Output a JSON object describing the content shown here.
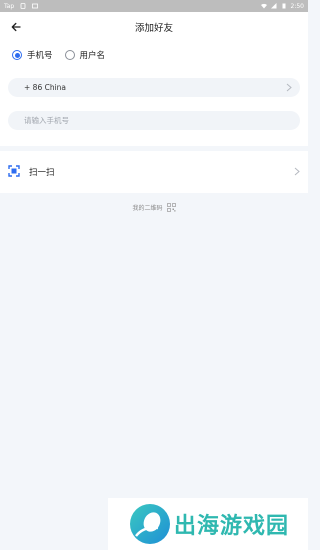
{
  "statusbar": {
    "left_text": "Tap",
    "time": "2:50"
  },
  "header": {
    "title": "添加好友",
    "back_icon": "arrow-left-icon"
  },
  "search_mode": {
    "options": [
      {
        "label": "手机号",
        "checked": true
      },
      {
        "label": "用户名",
        "checked": false
      }
    ],
    "accent": "#2d6cf0"
  },
  "country": {
    "value": "+ 86 China"
  },
  "phone": {
    "placeholder": "请输入手机号"
  },
  "scan": {
    "label": "扫一扫",
    "icon": "scan-icon"
  },
  "my_qr": {
    "label": "我的二维码",
    "icon": "qr-code-icon"
  },
  "watermark": {
    "text": "出海游戏园",
    "color": "#2fb8b0"
  }
}
